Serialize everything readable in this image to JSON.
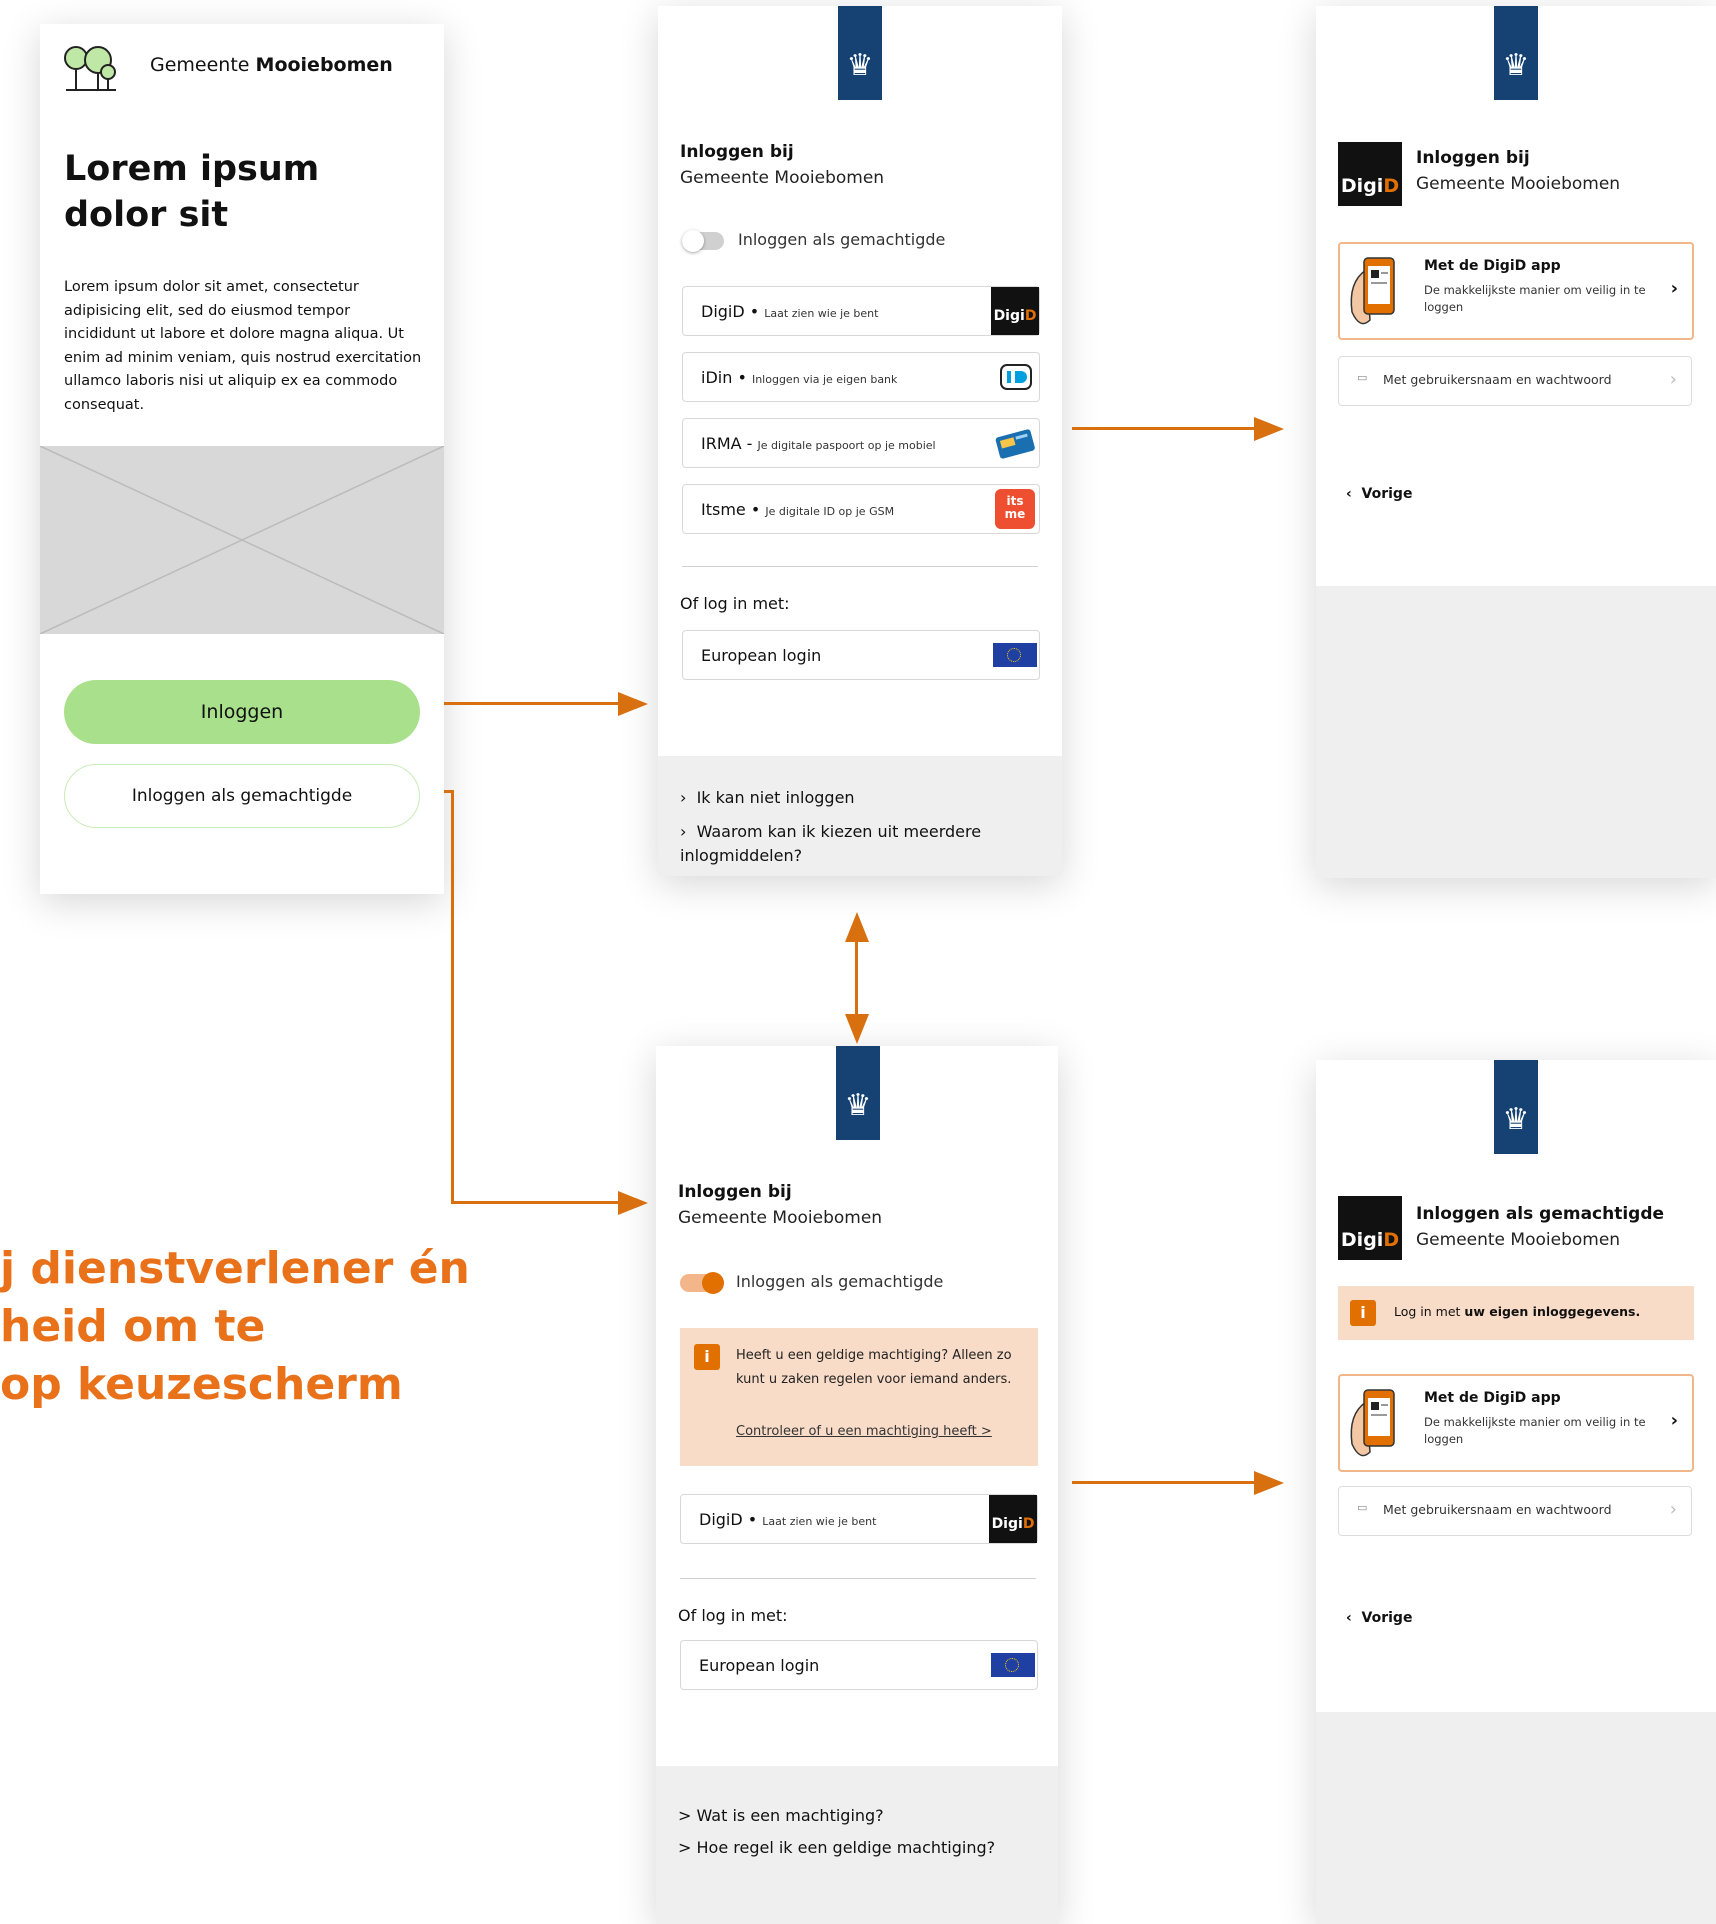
{
  "screen1": {
    "brand_prefix": "Gemeente ",
    "brand_bold": "Mooiebomen",
    "heading_line1": "Lorem ipsum",
    "heading_line2": "dolor sit",
    "body": "Lorem ipsum dolor sit amet, consectetur adipisicing elit, sed do eiusmod tempor incididunt ut labore et dolore magna aliqua. Ut enim ad minim veniam, quis nostrud exercitation ullamco laboris nisi ut aliquip ex ea commodo consequat.",
    "login_button": "Inloggen",
    "proxy_button": "Inloggen als gemachtigde",
    "colors": {
      "login_button": "#a8e08b",
      "proxy_border": "#c9ecb8"
    }
  },
  "screen2": {
    "title_line1": "Inloggen bij",
    "title_line2": "Gemeente Mooiebomen",
    "toggle_label": "Inloggen als gemachtigde",
    "options": [
      {
        "name": "DigiD",
        "desc": "Laat zien wie je bent",
        "icon": "digid-logo"
      },
      {
        "name": "iDin",
        "desc": "Inloggen via je eigen bank",
        "icon": "idin-logo"
      },
      {
        "name": "IRMA",
        "desc": "Je digitale paspoort op je mobiel",
        "icon": "irma-logo"
      },
      {
        "name": "Itsme",
        "desc": "Je digitale ID op je GSM",
        "icon": "itsme-logo"
      }
    ],
    "or_label": "Of log in met:",
    "european_login": "European login",
    "help_links": [
      "Ik kan niet inloggen",
      "Waarom kan ik kiezen uit meerdere inlogmiddelen?"
    ]
  },
  "screen3": {
    "title_line1": "Inloggen bij",
    "title_line2": "Gemeente Mooiebomen",
    "app_card_title": "Met de DigiD app",
    "app_card_desc": "De makkelijkste manier om veilig in te loggen",
    "password_card": "Met gebruikersnaam en wachtwoord",
    "back": "Vorige"
  },
  "screen4": {
    "title_line1": "Inloggen bij",
    "title_line2": "Gemeente Mooiebomen",
    "toggle_label": "Inloggen als gemachtigde",
    "notice_text": "Heeft u een geldige machtiging? Alleen zo kunt u zaken regelen voor iemand anders.",
    "notice_link": "Controleer of u een machtiging heeft >",
    "option_name": "DigiD",
    "option_desc": "Laat zien wie je bent",
    "or_label": "Of log in met:",
    "european_login": "European login",
    "help_links": [
      "> Wat is een machtiging?",
      "> Hoe regel ik een geldige machtiging?"
    ]
  },
  "screen5": {
    "title_line1": "Inloggen als gemachtigde",
    "title_line2": "Gemeente Mooiebomen",
    "notice_prefix": "Log in met ",
    "notice_bold": "uw eigen inloggegevens.",
    "app_card_title": "Met de DigiD app",
    "app_card_desc": "De makkelijkste manier om veilig in te loggen",
    "password_card": "Met gebruikersnaam en wachtwoord",
    "back": "Vorige"
  },
  "digid_logo": {
    "part1": "Digi",
    "part2": "D"
  },
  "annotation": {
    "line1": "j dienstverlener én",
    "line2": "heid om te",
    "line3": "op keuzescherm"
  },
  "colors": {
    "accent": "#e17000",
    "arrow": "#d9700f",
    "rijks_blue": "#154273",
    "notice_bg": "#f9dcc8",
    "eu_blue": "#1f3fa3"
  }
}
